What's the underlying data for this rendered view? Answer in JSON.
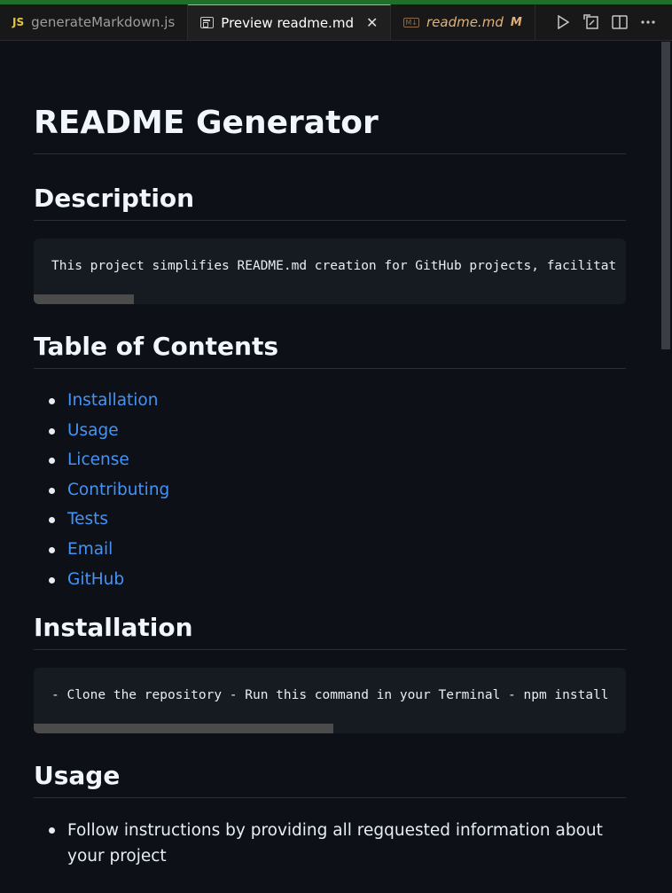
{
  "tabs": [
    {
      "icon": "JS",
      "label": "generateMarkdown.js",
      "active": false
    },
    {
      "label": "Preview readme.md",
      "active": true,
      "close": "✕"
    },
    {
      "icon": "M↓",
      "label": "readme.md",
      "modified_badge": "M",
      "active": false
    }
  ],
  "doc": {
    "title": "README Generator",
    "description_heading": "Description",
    "description_code": "This project simplifies README.md creation for GitHub projects, facilitat",
    "toc_heading": "Table of Contents",
    "toc": [
      "Installation",
      "Usage",
      "License",
      "Contributing",
      "Tests",
      "Email",
      "GitHub"
    ],
    "installation_heading": "Installation",
    "installation_code": "- Clone the repository - Run this command in your Terminal - npm install",
    "usage_heading": "Usage",
    "usage_items": [
      "Follow instructions by providing all regquested information about your project"
    ]
  },
  "colors": {
    "link": "#4493f8",
    "background": "#0d1117",
    "code_bg": "#161b22"
  },
  "icons": [
    "run-icon",
    "open-to-side-icon",
    "split-editor-icon",
    "more-actions-icon"
  ]
}
